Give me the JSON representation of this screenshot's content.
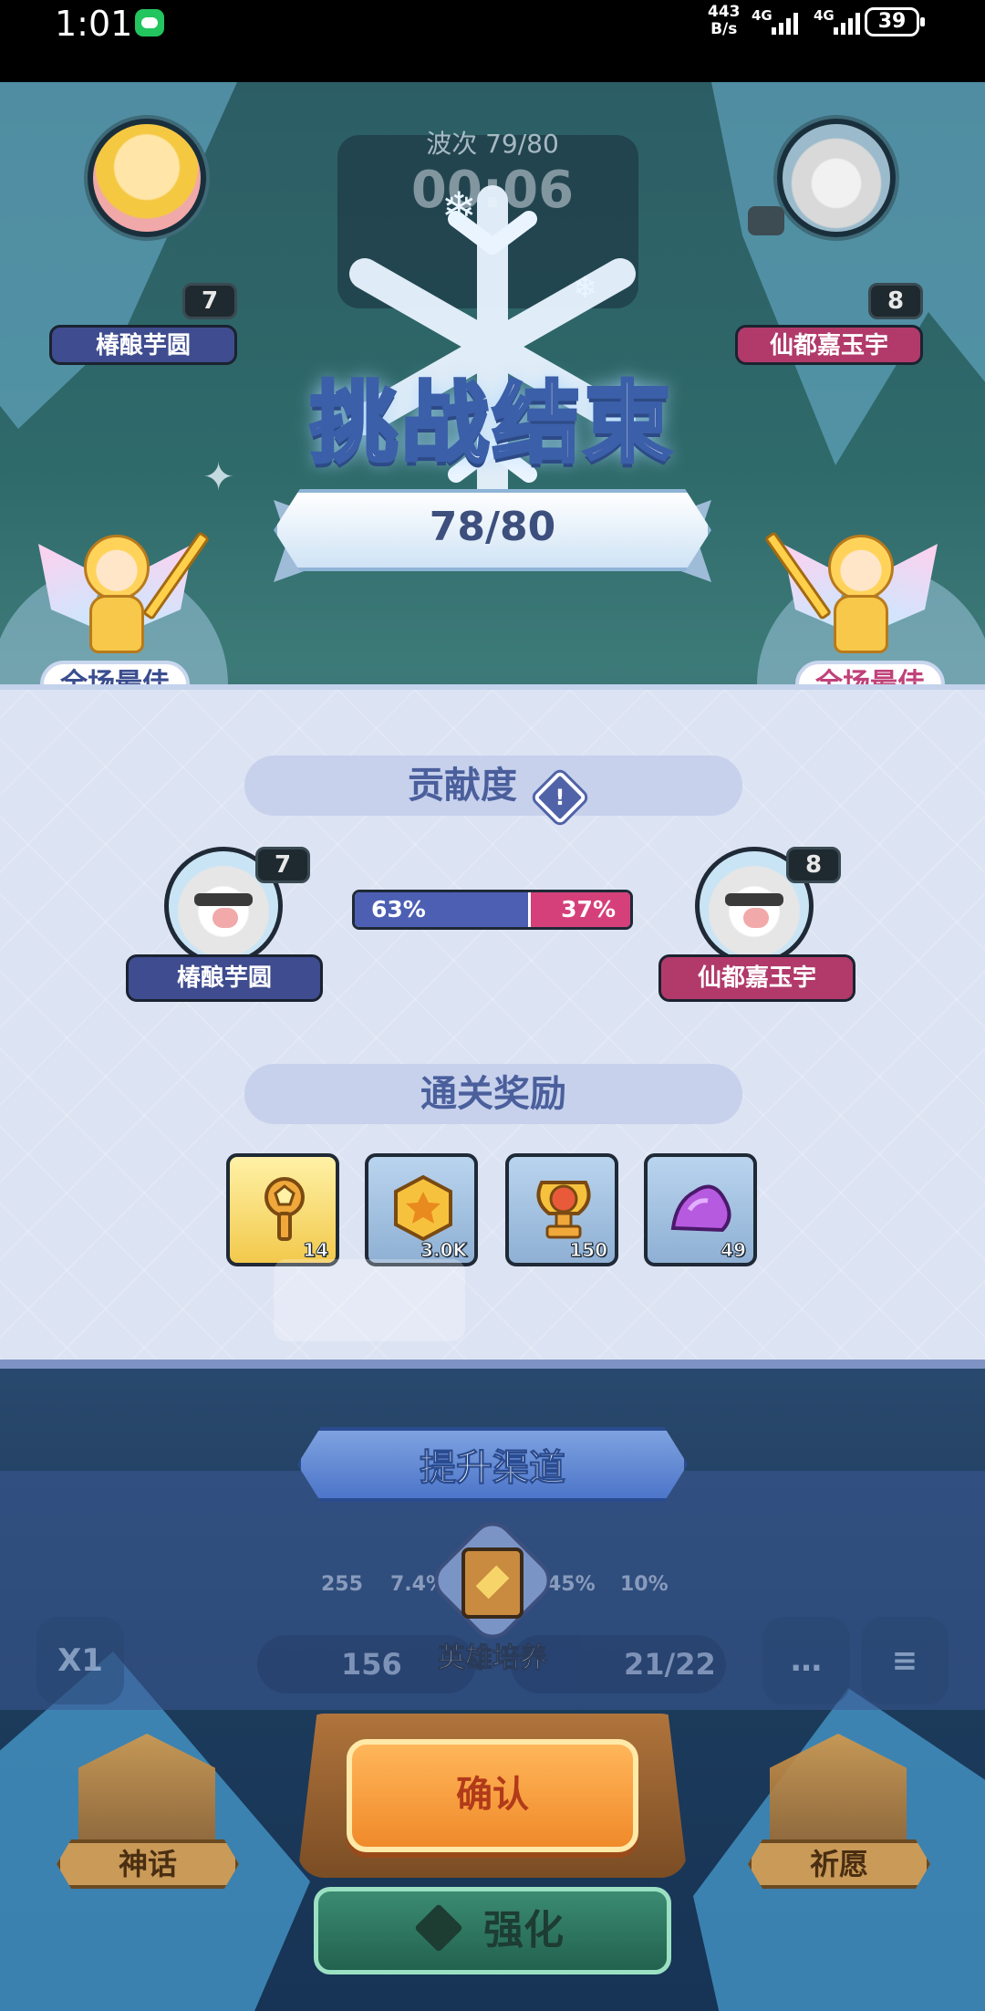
{
  "status_bar": {
    "time": "1:01",
    "net_speed_value": "443",
    "net_speed_unit": "B/s",
    "network_1": "4G",
    "network_2": "4G",
    "battery": "39"
  },
  "top_hud": {
    "wave": "波次 79/80",
    "timer": "00:06",
    "left_player": {
      "name": "椿酿芋圆",
      "level": "7"
    },
    "right_player": {
      "name": "仙都嘉玉宇",
      "level": "8"
    }
  },
  "result": {
    "title": "挑战结束",
    "score": "78/80",
    "mvp_label": "全场最佳"
  },
  "contribution": {
    "heading": "贡献度",
    "info_glyph": "!",
    "left": {
      "name": "椿酿芋圆",
      "level": "7",
      "percent_label": "63%",
      "percent": 63
    },
    "right": {
      "name": "仙都嘉玉宇",
      "level": "8",
      "percent_label": "37%",
      "percent": 37
    },
    "colors": {
      "left": "#4d5fb3",
      "right": "#d5407a"
    }
  },
  "rewards": {
    "heading": "通关奖励",
    "items": [
      {
        "icon": "key-icon",
        "qty": "14"
      },
      {
        "icon": "coin-icon",
        "qty": "3.0K"
      },
      {
        "icon": "trophy-icon",
        "qty": "150"
      },
      {
        "icon": "crystal-icon",
        "qty": "49"
      }
    ]
  },
  "upgrade": {
    "heading": "提升渠道",
    "channel_label": "英雄培养"
  },
  "background_hud": {
    "stats": [
      "255",
      "7.4%",
      "45%",
      "10%"
    ],
    "coins": "156",
    "units": "21/22",
    "speed": "X1"
  },
  "bottom": {
    "confirm": "确认",
    "strengthen": "强化",
    "myth": "神话",
    "wish": "祈愿"
  }
}
